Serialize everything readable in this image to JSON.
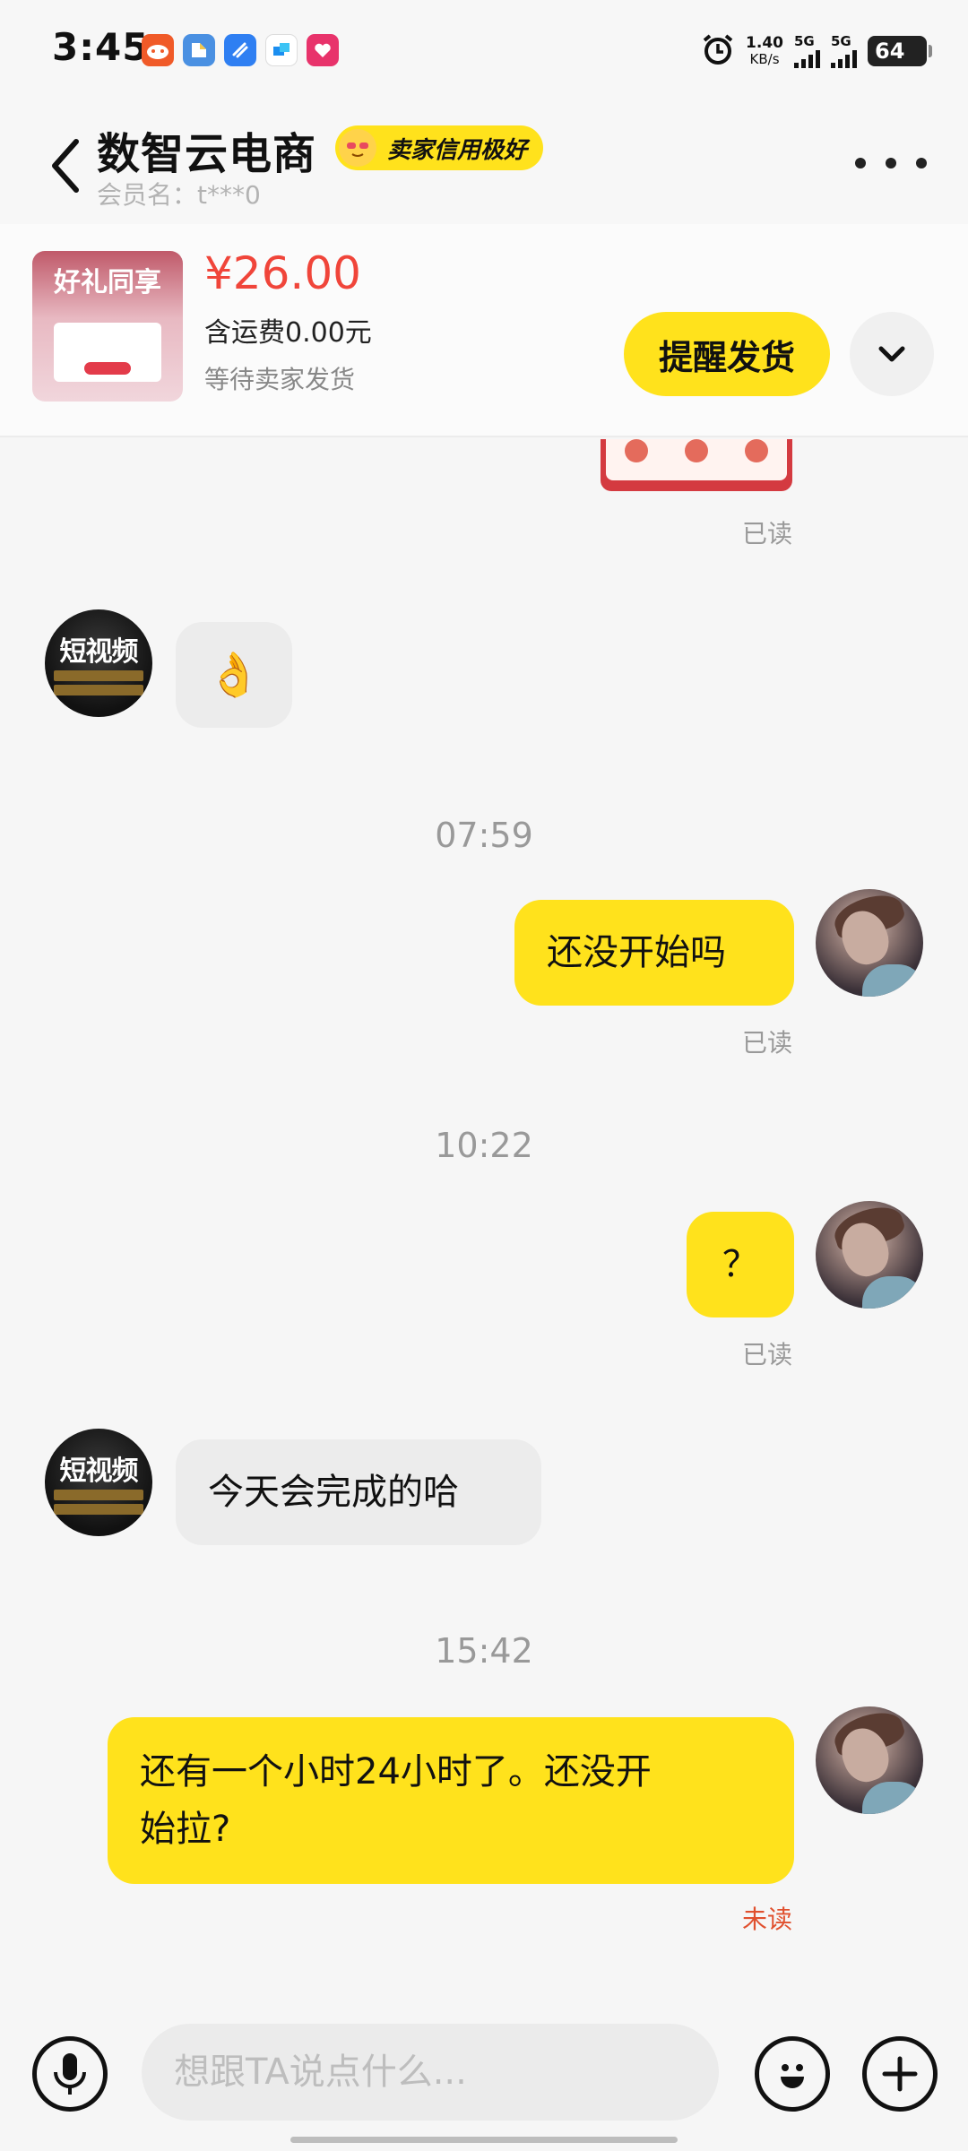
{
  "status_bar": {
    "time": "3:45",
    "net_speed_value": "1.40",
    "net_speed_unit": "KB/s",
    "sim1_label": "5G",
    "sim2_label": "5G",
    "battery": "64",
    "app_icons": [
      "taobao-red-icon",
      "files-icon",
      "blue-app-icon",
      "lark-icon",
      "pink-app-icon"
    ]
  },
  "header": {
    "shop_name": "数智云电商",
    "credit_badge": "卖家信用极好",
    "member_label": "会员名：t***0"
  },
  "order": {
    "thumb_text": "好礼同享",
    "price": "¥26.00",
    "shipping": "含运费0.00元",
    "status": "等待卖家发货",
    "remind_button": "提醒发货"
  },
  "chat": {
    "top_read": "已读",
    "seller_avatar_text": "短视频",
    "msg_ok_emoji": "👌",
    "time1": "07:59",
    "msg1": "还没开始吗",
    "msg1_read": "已读",
    "time2": "10:22",
    "msg2": "？",
    "msg2_read": "已读",
    "msg3": "今天会完成的哈",
    "time3": "15:42",
    "msg4_line1": "还有一个小时24小时了。还没开",
    "msg4_line2": "始拉?",
    "msg4_status": "未读"
  },
  "input_bar": {
    "placeholder": "想跟TA说点什么..."
  },
  "colors": {
    "accent_yellow": "#ffe21c",
    "price_red": "#f0453a",
    "unread_orange": "#e0502e"
  }
}
